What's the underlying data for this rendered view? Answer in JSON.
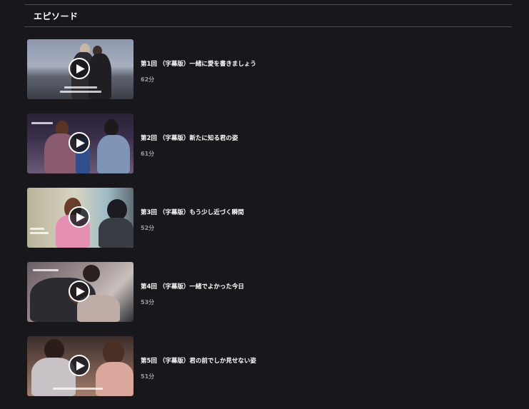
{
  "section": {
    "title": "エピソード"
  },
  "episodes": [
    {
      "title": "第1回 （字幕版）一緒に愛を書きましょう",
      "duration": "62分",
      "play_icon": "play-icon"
    },
    {
      "title": "第2回 （字幕版）新たに知る君の姿",
      "duration": "61分",
      "play_icon": "play-icon"
    },
    {
      "title": "第3回 （字幕版）もう少し近づく瞬間",
      "duration": "52分",
      "play_icon": "play-icon"
    },
    {
      "title": "第4回 （字幕版）一緒でよかった今日",
      "duration": "53分",
      "play_icon": "play-icon"
    },
    {
      "title": "第5回 （字幕版）君の前でしか見せない姿",
      "duration": "51分",
      "play_icon": "play-icon"
    }
  ]
}
